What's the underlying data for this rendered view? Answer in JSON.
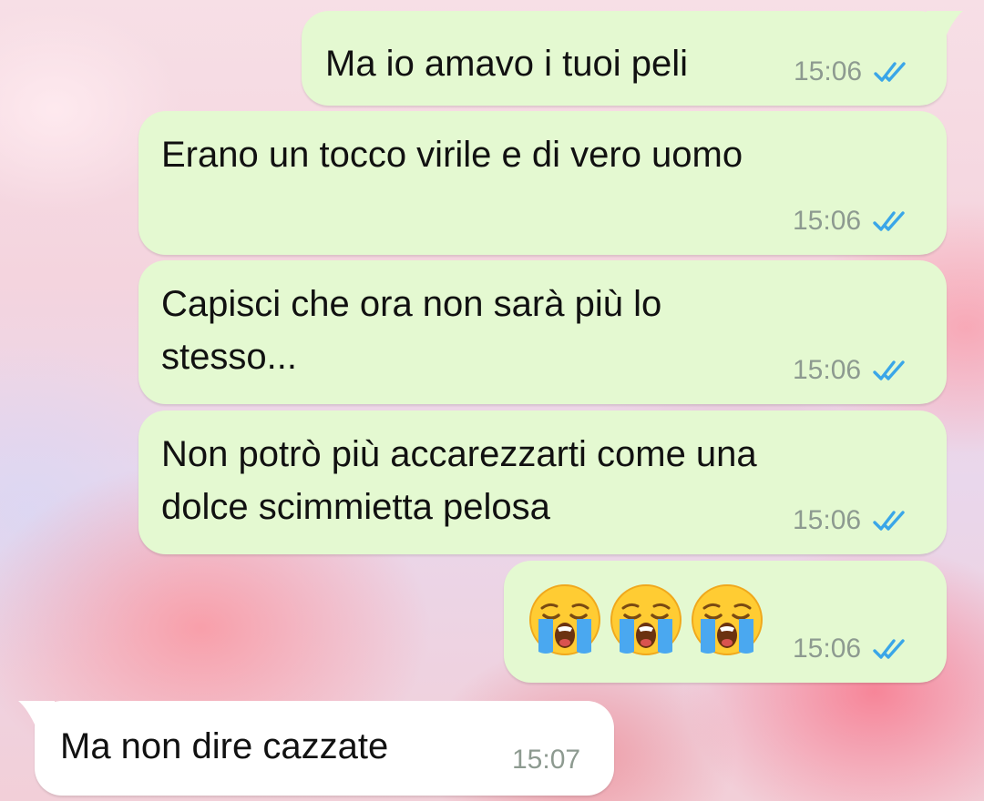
{
  "messages": [
    {
      "text": "Ma io amavo i tuoi peli",
      "time": "15:06",
      "status": "read",
      "direction": "outgoing"
    },
    {
      "text": "Erano un tocco virile e di vero uomo",
      "time": "15:06",
      "status": "read",
      "direction": "outgoing"
    },
    {
      "text_lines": [
        "Capisci che ora non sarà più lo",
        "stesso..."
      ],
      "time": "15:06",
      "status": "read",
      "direction": "outgoing"
    },
    {
      "text_lines": [
        "Non potrò più accarezzarti come una",
        "dolce scimmietta pelosa"
      ],
      "time": "15:06",
      "status": "read",
      "direction": "outgoing"
    },
    {
      "emojis": [
        "loudly-crying-face",
        "loudly-crying-face",
        "loudly-crying-face"
      ],
      "time": "15:06",
      "status": "read",
      "direction": "outgoing"
    },
    {
      "text": "Ma non dire cazzate",
      "time": "15:07",
      "direction": "incoming"
    }
  ],
  "colors": {
    "outgoing_bubble": "#e4f9d1",
    "incoming_bubble": "#ffffff",
    "read_ticks": "#3aa6e8",
    "timestamp": "#8d9a90"
  }
}
